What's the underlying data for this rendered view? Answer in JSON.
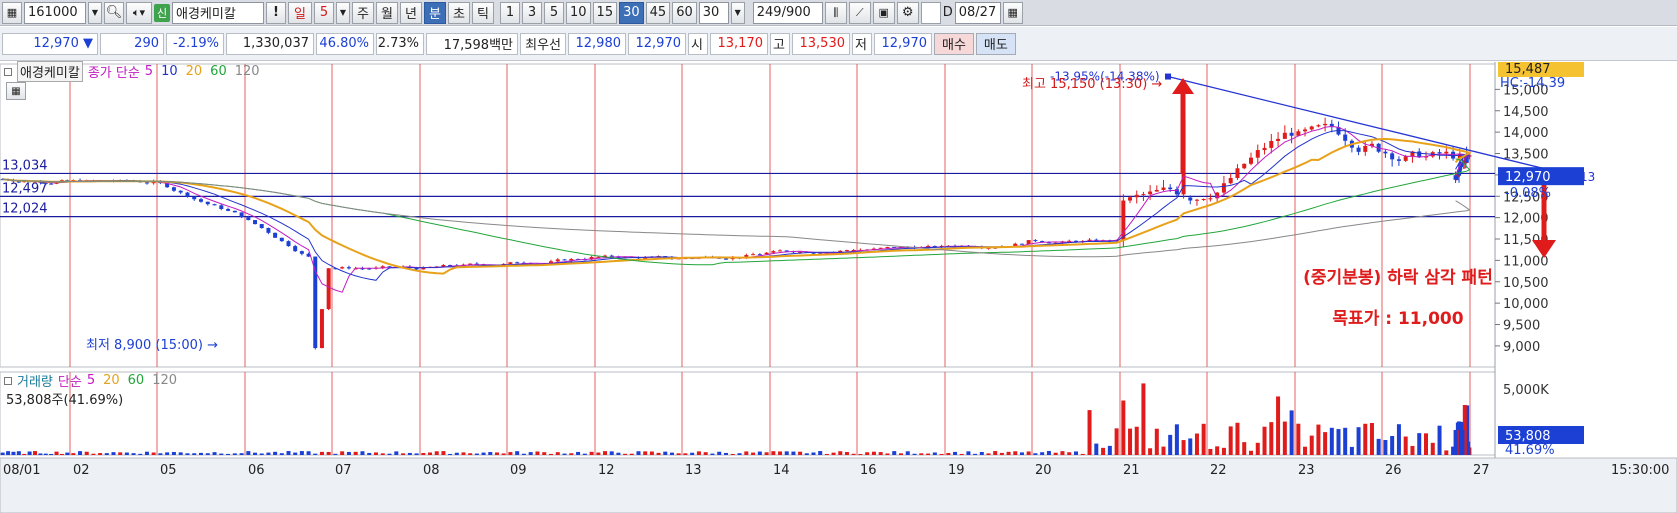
{
  "toolbar": {
    "code": "161000",
    "badge": "신",
    "name": "애경케미칼",
    "alert": "!",
    "period_day": "일",
    "period_num": "5",
    "period_week": "주",
    "period_month": "월",
    "period_year": "년",
    "period_min": "분",
    "period_sec": "초",
    "period_tick": "틱",
    "intervals": [
      "1",
      "3",
      "5",
      "10",
      "15",
      "30",
      "45",
      "60"
    ],
    "active_interval": "30",
    "interval_select": "30",
    "count": "249",
    "count_total": "/900",
    "date_check_label": "D",
    "date": "08/27"
  },
  "quote": {
    "price": "12,970",
    "change": "290",
    "change_pct": "-2.19%",
    "volume": "1,330,037",
    "vol_ratio": "46.80%",
    "turnover": "2.73%",
    "amount": "17,598백만",
    "best_label": "최우선",
    "ask": "12,980",
    "bid": "12,970",
    "open_label": "시",
    "open": "13,170",
    "high_label": "고",
    "high": "13,530",
    "low_label": "저",
    "low": "12,970",
    "buy": "매수",
    "sell": "매도"
  },
  "price_panel": {
    "legend_name": "애경케미칼",
    "legend_ma_label": "종가 단순",
    "ma_periods": [
      "5",
      "10",
      "20",
      "60",
      "120"
    ],
    "ma_colors": [
      "#c21cc2",
      "#2233cc",
      "#e8a21a",
      "#22a63a",
      "#888888"
    ],
    "level_labels": [
      "13,034",
      "12,497",
      "12,024"
    ],
    "y_ticks": [
      "15,000",
      "14,500",
      "14,000",
      "13,500",
      "13,000",
      "12,500",
      "12,000",
      "11,500",
      "11,000",
      "10,500",
      "10,000",
      "9,500",
      "9,000"
    ],
    "top_right_value": "15,487",
    "hc_label": "HC:-14.39",
    "current_price_tag": "12,970",
    "current_pct_tag": "-0.08%",
    "trend_pct_label": "-13.95%(-14.38%)",
    "trend_end_label": "13",
    "high_marker": "최고 15,150 (13:30) →",
    "low_marker": "최저 8,900 (15:00) →",
    "annotation_title": "(중기분봉) 하락 삼각 패턴",
    "annotation_target": "목표가 : 11,000"
  },
  "volume_panel": {
    "legend_name": "거래량",
    "legend_ma_label": "단순",
    "ma_periods": [
      "5",
      "20",
      "60",
      "120"
    ],
    "ma_colors": [
      "#c21cc2",
      "#e8a21a",
      "#22a63a",
      "#888888"
    ],
    "sub_label": "53,808주(41.69%)",
    "y_tick": "5,000K",
    "current_tag": "53,808",
    "current_pct_tag": "41.69%"
  },
  "x_axis": {
    "labels": [
      "08/01",
      "02",
      "05",
      "06",
      "07",
      "08",
      "09",
      "12",
      "13",
      "14",
      "16",
      "19",
      "20",
      "21",
      "22",
      "23",
      "26",
      "27"
    ],
    "time_label": "15:30:00"
  },
  "colors": {
    "up": "#e01b1b",
    "down": "#1c3fd4",
    "grid_vertical": "#e03b3b",
    "support_line": "#1a1aa0",
    "trend_line": "#2433d4"
  },
  "chart_data": {
    "type": "candlestick",
    "y_scale": [
      8600,
      15500
    ],
    "support_levels": [
      13034,
      12497,
      12024
    ],
    "session_close_approx": [
      12860,
      12820,
      12040,
      10830,
      10820,
      10900,
      11060,
      11040,
      11170,
      11260,
      11310,
      11440,
      11450,
      12520,
      14020,
      13640,
      13380,
      12970
    ],
    "high": 15150,
    "low": 8900,
    "target": 11000
  }
}
